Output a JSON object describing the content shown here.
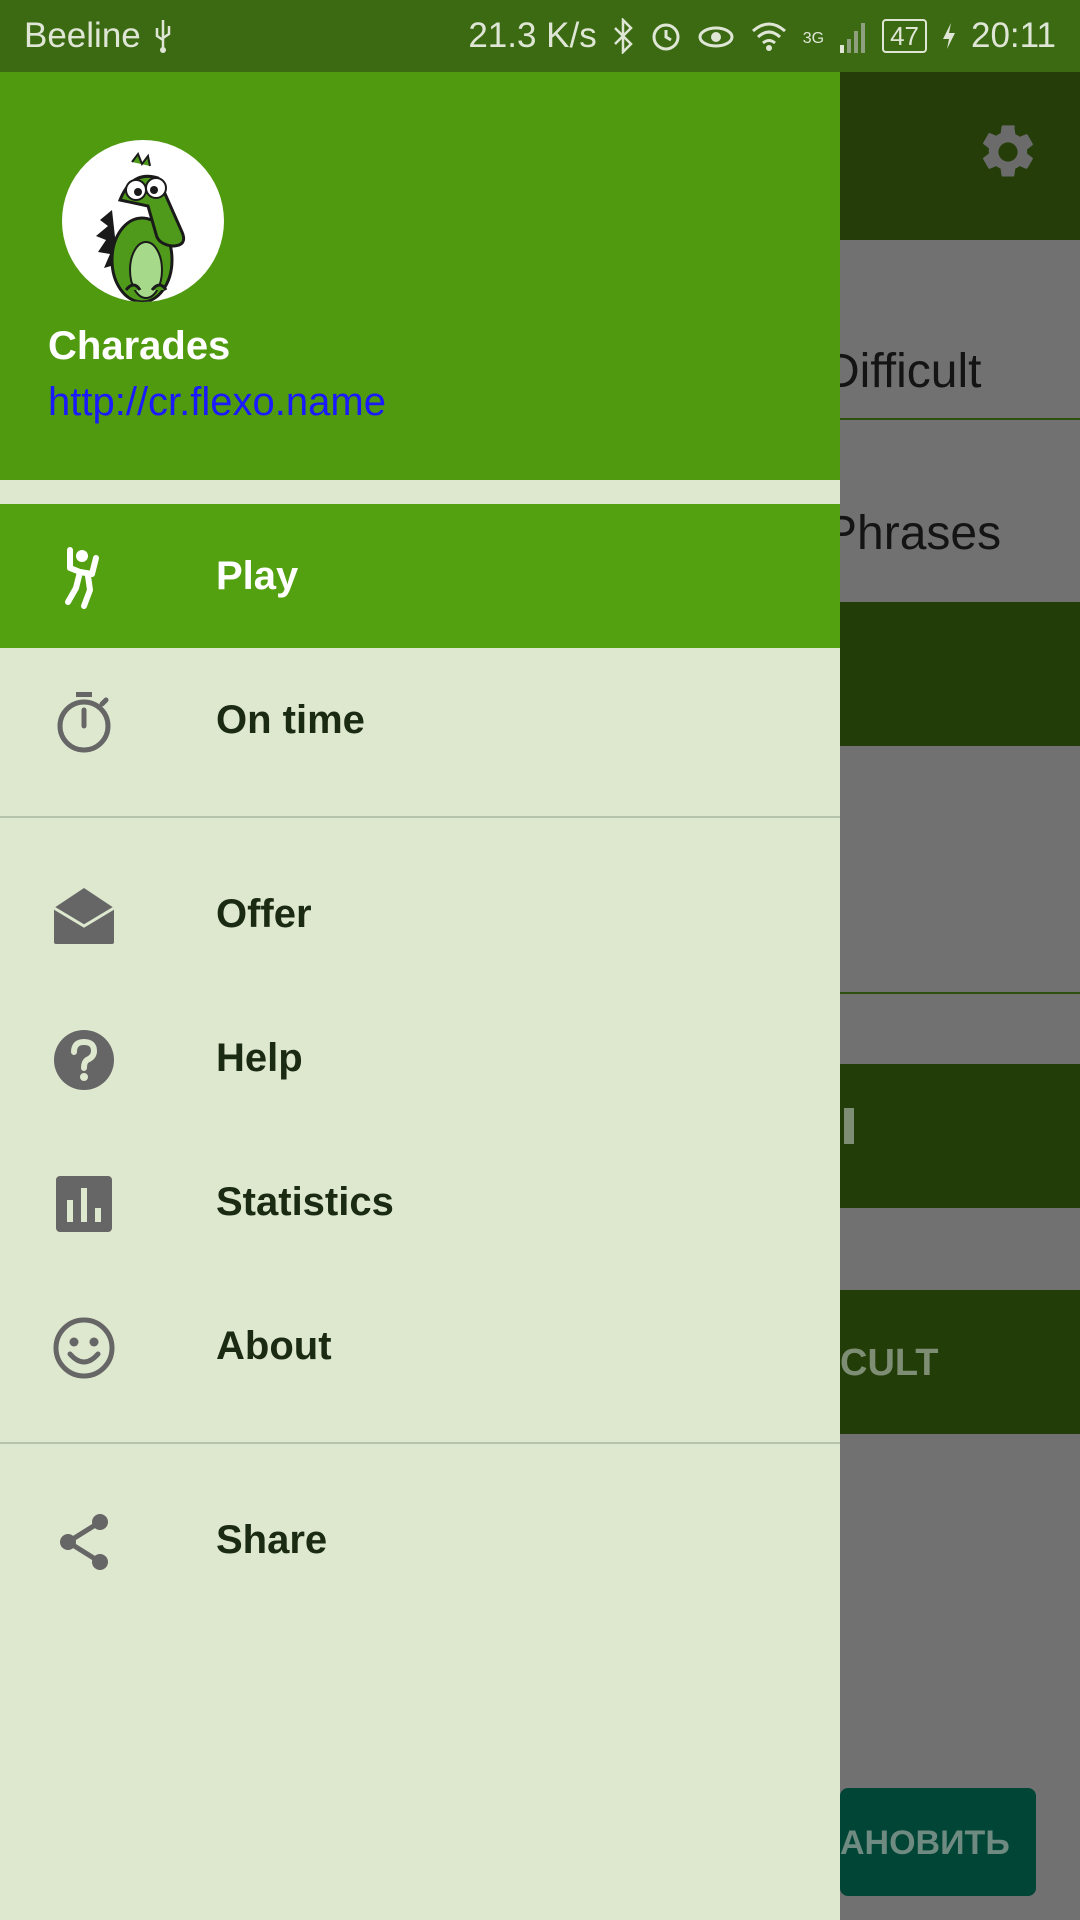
{
  "status_bar": {
    "carrier": "Beeline",
    "speed": "21.3 K/s",
    "network": "3G",
    "battery": "47",
    "time": "20:11"
  },
  "background": {
    "item1": "Difficult",
    "item2": "Phrases",
    "button2": "CULT",
    "button_bottom": "АНОВИТЬ"
  },
  "drawer": {
    "app_name": "Charades",
    "app_url": "http://cr.flexo.name",
    "items": [
      {
        "label": "Play",
        "icon": "dance-icon"
      },
      {
        "label": "On time",
        "icon": "timer-icon"
      },
      {
        "label": "Offer",
        "icon": "mail-open-icon"
      },
      {
        "label": "Help",
        "icon": "help-icon"
      },
      {
        "label": "Statistics",
        "icon": "statistics-icon"
      },
      {
        "label": "About",
        "icon": "smiley-icon"
      },
      {
        "label": "Share",
        "icon": "share-icon"
      }
    ]
  },
  "colors": {
    "header_green": "#4f9a0e",
    "active_item": "#53a011",
    "drawer_bg": "#dde8cf",
    "link": "#1a1aff"
  }
}
